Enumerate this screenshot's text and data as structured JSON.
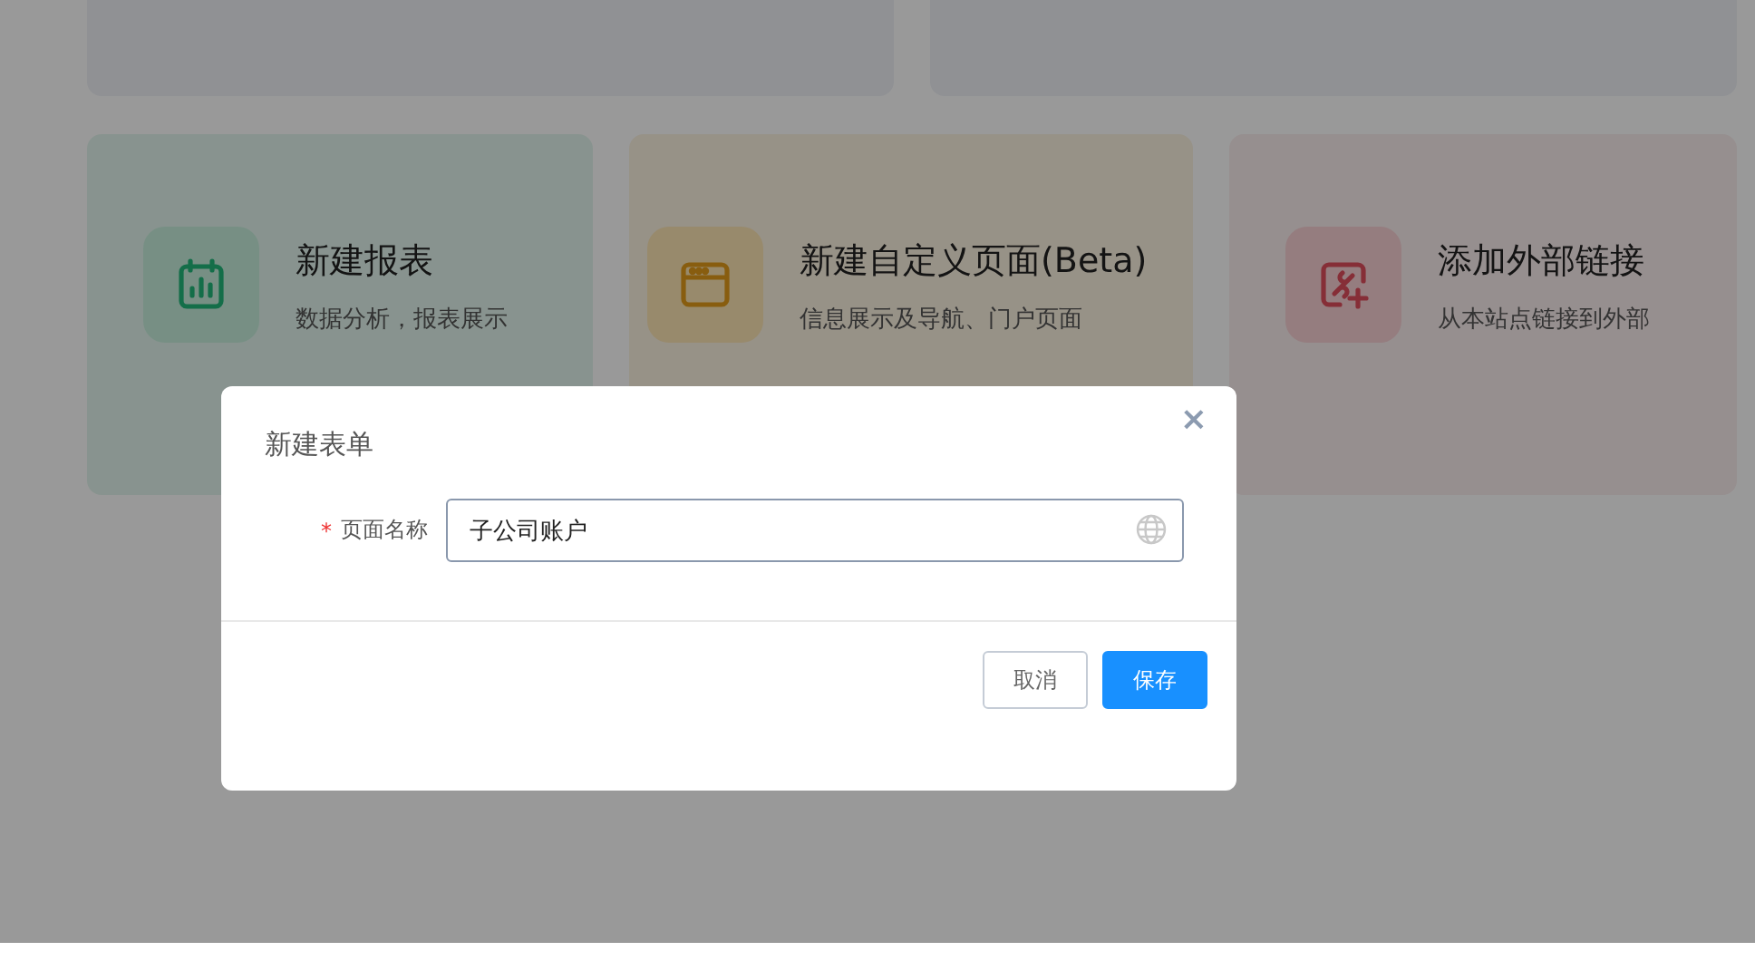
{
  "top_cards": [
    {
      "kind": "blank"
    },
    {
      "kind": "blank"
    }
  ],
  "cards": [
    {
      "kind": "report",
      "title": "新建报表",
      "subtitle": "数据分析，报表展示"
    },
    {
      "kind": "page",
      "title": "新建自定义页面(Beta)",
      "subtitle": "信息展示及导航、门户页面"
    },
    {
      "kind": "link",
      "title": "添加外部链接",
      "subtitle": "从本站点链接到外部"
    }
  ],
  "dialog": {
    "title": "新建表单",
    "close": "×",
    "field": {
      "required_mark": "*",
      "label": "页面名称",
      "value": "子公司账户"
    },
    "buttons": [
      {
        "kind": "secondary",
        "label": "取消"
      },
      {
        "kind": "primary",
        "label": "保存"
      }
    ]
  }
}
